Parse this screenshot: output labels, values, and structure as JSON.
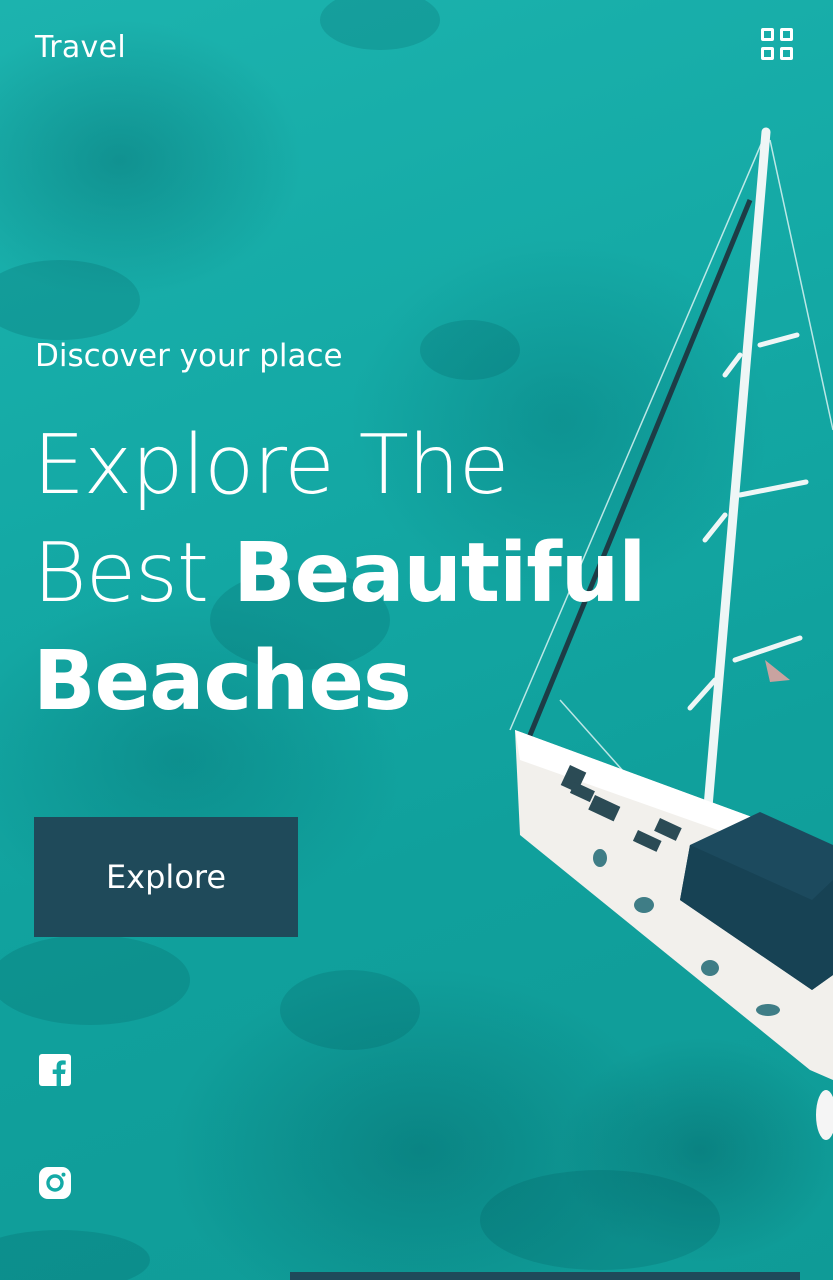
{
  "header": {
    "brand": "Travel",
    "menu_icon": "grid-menu-icon"
  },
  "hero": {
    "tagline": "Discover your place",
    "headline_line1": "Explore The",
    "headline_line2_light": "Best",
    "headline_line2_bold": "Beautiful",
    "headline_line3_bold": "Beaches",
    "cta_label": "Explore",
    "background": "aerial-sailboat-turquoise-sea"
  },
  "social": [
    {
      "icon": "facebook-icon"
    },
    {
      "icon": "instagram-icon"
    }
  ],
  "colors": {
    "sea": "#14aaa6",
    "button": "#1f4a5a",
    "text": "#ffffff"
  }
}
